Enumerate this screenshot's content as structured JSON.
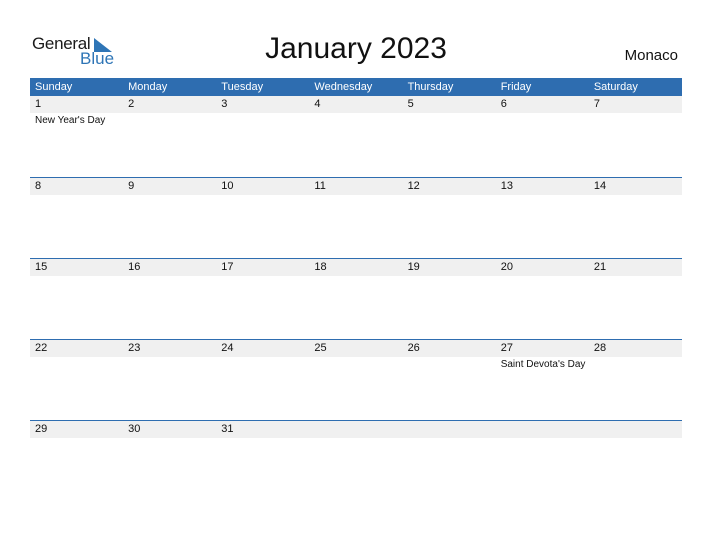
{
  "logo": {
    "general": "General",
    "blue": "Blue"
  },
  "title": "January 2023",
  "country": "Monaco",
  "weekdays": [
    "Sunday",
    "Monday",
    "Tuesday",
    "Wednesday",
    "Thursday",
    "Friday",
    "Saturday"
  ],
  "weeks": [
    {
      "days": [
        "1",
        "2",
        "3",
        "4",
        "5",
        "6",
        "7"
      ],
      "events": [
        "New Year's Day",
        "",
        "",
        "",
        "",
        "",
        ""
      ]
    },
    {
      "days": [
        "8",
        "9",
        "10",
        "11",
        "12",
        "13",
        "14"
      ],
      "events": [
        "",
        "",
        "",
        "",
        "",
        "",
        ""
      ]
    },
    {
      "days": [
        "15",
        "16",
        "17",
        "18",
        "19",
        "20",
        "21"
      ],
      "events": [
        "",
        "",
        "",
        "",
        "",
        "",
        ""
      ]
    },
    {
      "days": [
        "22",
        "23",
        "24",
        "25",
        "26",
        "27",
        "28"
      ],
      "events": [
        "",
        "",
        "",
        "",
        "",
        "Saint Devota's Day",
        ""
      ]
    },
    {
      "days": [
        "29",
        "30",
        "31",
        "",
        "",
        "",
        ""
      ],
      "events": [
        "",
        "",
        "",
        "",
        "",
        "",
        ""
      ]
    }
  ],
  "colors": {
    "accent": "#2e6db0",
    "logo_blue": "#2e75b6",
    "date_row_bg": "#f0f0f0"
  }
}
